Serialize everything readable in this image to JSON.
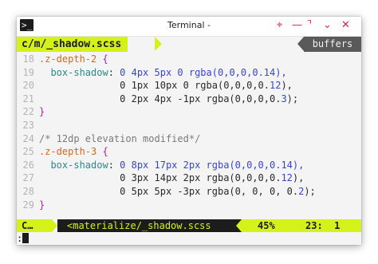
{
  "window": {
    "title": "Terminal -",
    "icon": "terminal-icon",
    "controls": {
      "pin": "⌖",
      "minimize": "—",
      "maximize": "⌝",
      "collapse": "⌄",
      "close": "✕"
    }
  },
  "tabline": {
    "file": "c/m/_shadow.scss",
    "buffers": "buffers"
  },
  "code": [
    {
      "n": "18",
      "parts": [
        {
          "t": ".z-depth-2 ",
          "c": "sel"
        },
        {
          "t": "{",
          "c": "brace"
        }
      ]
    },
    {
      "n": "19",
      "parts": [
        {
          "t": "  box-shadow",
          "c": "prop"
        },
        {
          "t": ": ",
          "c": "txt"
        },
        {
          "t": "0 4px 5px 0 ",
          "c": "num"
        },
        {
          "t": "rgba",
          "c": "fn"
        },
        {
          "t": "(0,0,0,0.14),",
          "c": "num"
        }
      ]
    },
    {
      "n": "20",
      "parts": [
        {
          "t": "              0 1px 10px 0 rgba(0,0,0,0.",
          "c": "txt"
        },
        {
          "t": "12",
          "c": "num"
        },
        {
          "t": "),",
          "c": "txt"
        }
      ]
    },
    {
      "n": "21",
      "parts": [
        {
          "t": "              0 2px 4px -1px rgba(0,0,0,0.",
          "c": "txt"
        },
        {
          "t": "3",
          "c": "num"
        },
        {
          "t": ");",
          "c": "txt"
        }
      ]
    },
    {
      "n": "22",
      "parts": [
        {
          "t": "}",
          "c": "brace"
        }
      ]
    },
    {
      "n": "23",
      "parts": []
    },
    {
      "n": "24",
      "parts": [
        {
          "t": "/* 12dp elevation modified*/",
          "c": "cmt"
        }
      ]
    },
    {
      "n": "25",
      "parts": [
        {
          "t": ".z-depth-3 ",
          "c": "sel"
        },
        {
          "t": "{",
          "c": "brace"
        }
      ]
    },
    {
      "n": "26",
      "parts": [
        {
          "t": "  box-shadow",
          "c": "prop"
        },
        {
          "t": ": ",
          "c": "txt"
        },
        {
          "t": "0 8px 17px 2px ",
          "c": "num"
        },
        {
          "t": "rgba",
          "c": "fn"
        },
        {
          "t": "(0,0,0,0.14),",
          "c": "num"
        }
      ]
    },
    {
      "n": "27",
      "parts": [
        {
          "t": "              0 3px 14px 2px rgba(0,0,0,0.",
          "c": "txt"
        },
        {
          "t": "12",
          "c": "num"
        },
        {
          "t": "),",
          "c": "txt"
        }
      ]
    },
    {
      "n": "28",
      "parts": [
        {
          "t": "              0 5px 5px -3px rgba(0, 0, 0, 0.",
          "c": "txt"
        },
        {
          "t": "2",
          "c": "num"
        },
        {
          "t": ");",
          "c": "txt"
        }
      ]
    },
    {
      "n": "29",
      "parts": [
        {
          "t": "}",
          "c": "brace"
        }
      ]
    }
  ],
  "statusline": {
    "mode": "C…",
    "file": "<materialize/_shadow.scss",
    "percent": "45%",
    "position": "23:  1"
  },
  "cmdline": {
    "text": ":"
  }
}
